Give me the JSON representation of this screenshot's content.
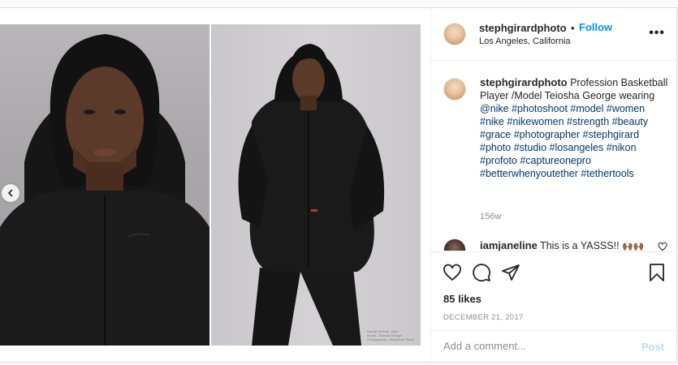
{
  "post": {
    "watermark_lines": [
      "Hoodie &Pants - Nike",
      "Model - Teiosha George",
      "Photographer - Stephanie Girard"
    ]
  },
  "header": {
    "username": "stephgirardphoto",
    "separator": "•",
    "follow_label": "Follow",
    "location": "Los Angeles, California",
    "more_label": "•••"
  },
  "caption": {
    "username": "stephgirardphoto",
    "text_plain": "Profession Basketball Player /Model Teiosha George wearing ",
    "tags": [
      "@nike",
      "#photoshoot",
      "#model",
      "#women",
      "#nike",
      "#nikewomen",
      "#strength",
      "#beauty",
      "#grace",
      "#photographer",
      "#stephgirard",
      "#photo",
      "#studio",
      "#losangeles",
      "#nikon",
      "#profoto",
      "#captureonepro",
      "#betterwhenyoutether",
      "#tethertools"
    ],
    "time_ago": "156w"
  },
  "comments": [
    {
      "username": "iamjaneline",
      "text": "This is a YASSS!!"
    }
  ],
  "actions": {
    "likes": "85 likes",
    "date": "DECEMBER 21, 2017"
  },
  "add_comment": {
    "placeholder": "Add a comment...",
    "post_label": "Post"
  },
  "colors": {
    "accent": "#0095f6",
    "hashtag": "#00376b",
    "muted": "#8e8e8e",
    "post_disabled": "#b2dffc"
  },
  "icons": [
    "chevron-left-icon",
    "more-icon",
    "heart-icon",
    "comment-icon",
    "share-icon",
    "bookmark-icon",
    "small-heart-icon"
  ]
}
